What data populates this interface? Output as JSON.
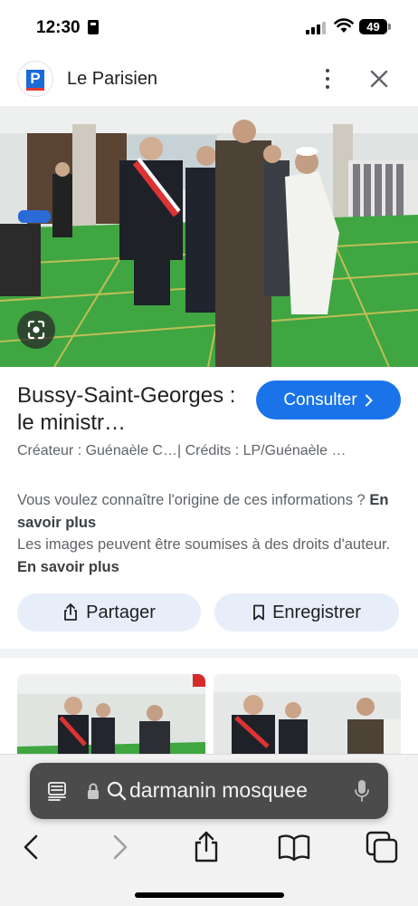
{
  "status_bar": {
    "time": "12:30",
    "battery": "49"
  },
  "source": {
    "name": "Le Parisien",
    "logo_letter": "P",
    "logo_color": "#1a6bd8",
    "logo_accent": "#e03a33"
  },
  "result": {
    "title": "Bussy-Saint-Georges : le ministr…",
    "consult_label": "Consulter",
    "consult_color": "#1a73e8",
    "credits": "Créateur : Guénaèle C…| Crédits : LP/Guénaèle …"
  },
  "info": {
    "line1": "Vous voulez connaître l'origine de ces informations ?",
    "link1": "En savoir plus",
    "line2": "Les images peuvent être soumises à des droits d'auteur.",
    "link2": "En savoir plus"
  },
  "actions": {
    "share_label": "Partager",
    "save_label": "Enregistrer"
  },
  "browser": {
    "search_query": "darmanin mosquee"
  },
  "icons": [
    "reader-icon",
    "lock-icon",
    "search-icon",
    "microphone-icon",
    "back-icon",
    "forward-icon",
    "share-icon",
    "bookmarks-icon",
    "tabs-icon",
    "more-icon",
    "close-icon",
    "lens-icon"
  ]
}
